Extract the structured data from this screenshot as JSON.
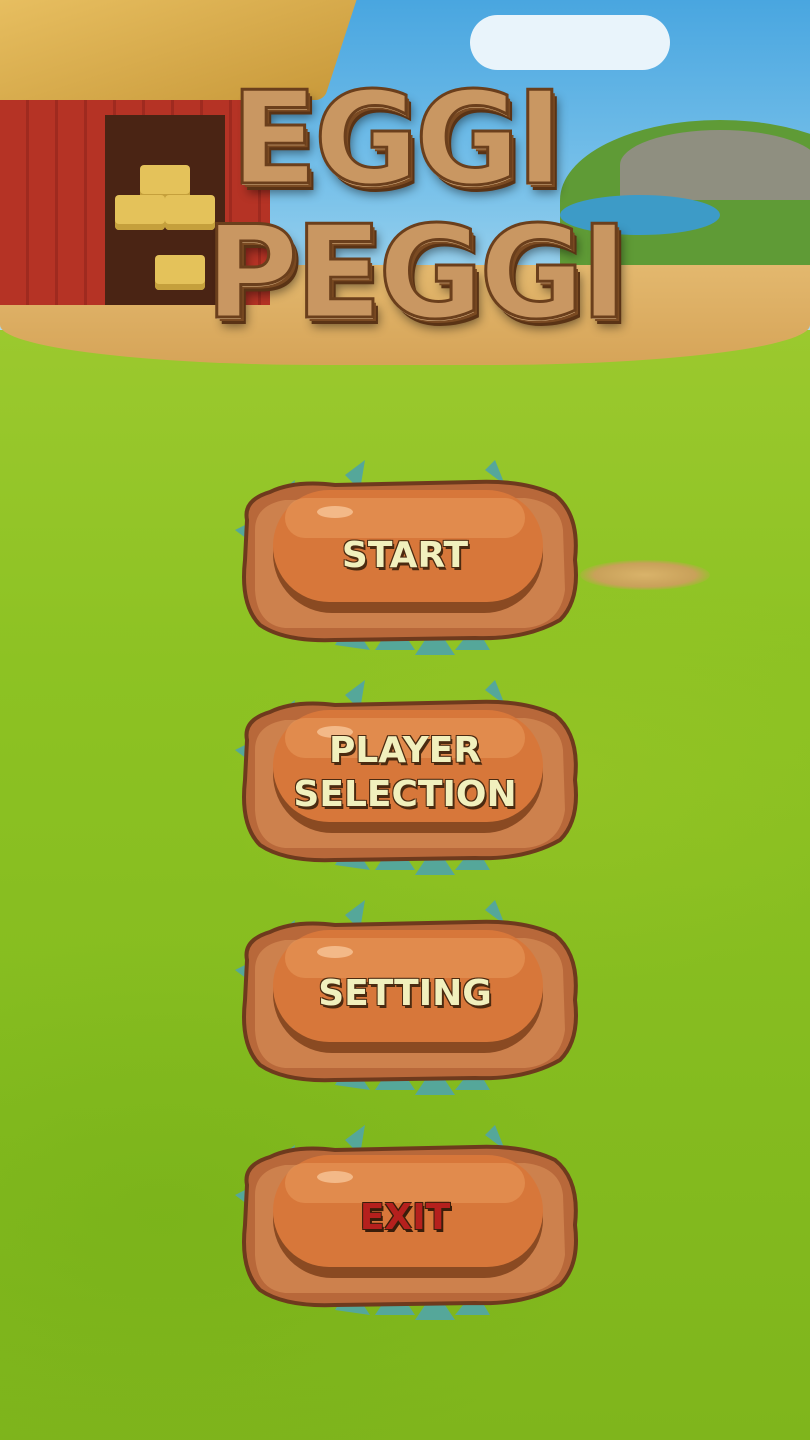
{
  "game": {
    "title_line1": "EGGI",
    "title_line2": "PEGGI"
  },
  "menu": {
    "buttons": [
      {
        "label": "START",
        "style": "normal"
      },
      {
        "label_line1": "PLAYER",
        "label_line2": "SELECTION",
        "style": "normal"
      },
      {
        "label": "SETTING",
        "style": "normal"
      },
      {
        "label": "EXIT",
        "style": "danger"
      }
    ]
  },
  "colors": {
    "grass": "#8cc121",
    "button_fill": "#d7773a",
    "button_border": "#8a4a22",
    "label_text": "#f1f0bd",
    "exit_text": "#b5201d",
    "title_wood": "#c99762"
  }
}
